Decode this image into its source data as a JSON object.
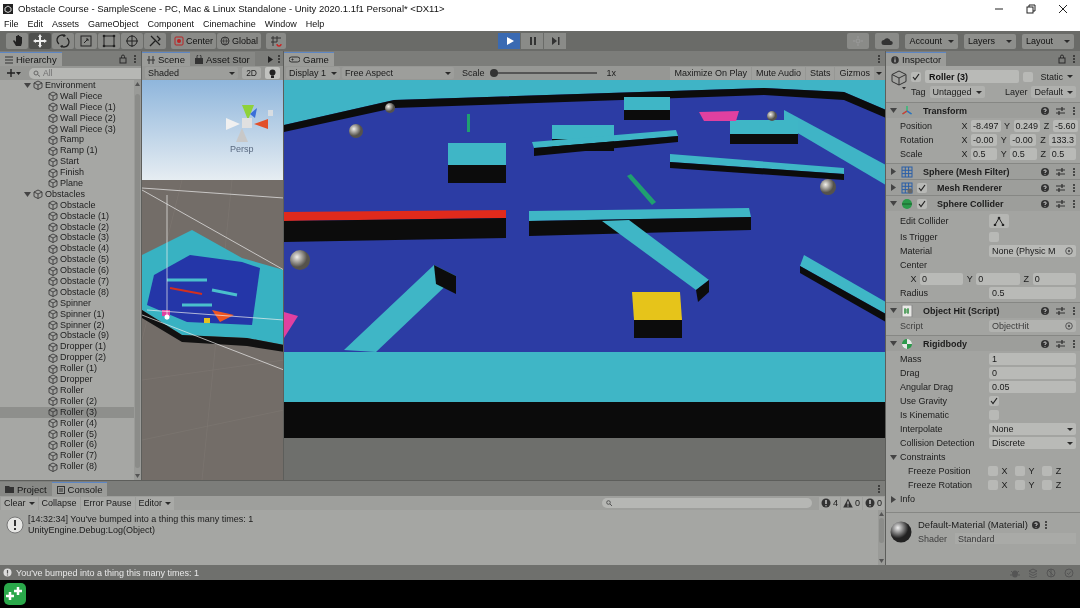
{
  "window": {
    "title": "Obstacle Course - SampleScene - PC, Mac & Linux Standalone - Unity 2020.1.1f1 Personal* <DX11>"
  },
  "menu": [
    "File",
    "Edit",
    "Assets",
    "GameObject",
    "Component",
    "Cinemachine",
    "Window",
    "Help"
  ],
  "toolbar": {
    "tools": [
      {
        "kind": "hand",
        "selected": false
      },
      {
        "kind": "move",
        "selected": true
      },
      {
        "kind": "rotate",
        "selected": false
      },
      {
        "kind": "scale",
        "selected": false
      },
      {
        "kind": "rect",
        "selected": false
      },
      {
        "kind": "transform",
        "selected": false
      },
      {
        "kind": "custom",
        "selected": false
      }
    ],
    "pivot": [
      {
        "kind": "center",
        "label": "Center"
      },
      {
        "kind": "global",
        "label": "Global"
      }
    ],
    "playback": [
      {
        "kind": "play",
        "on": true
      },
      {
        "kind": "pause",
        "on": false
      },
      {
        "kind": "step",
        "on": false
      }
    ],
    "menus": [
      "Account",
      "Layers",
      "Layout"
    ]
  },
  "hierarchy": {
    "title": "Hierarchy",
    "search": {
      "placeholder": "All"
    },
    "items": [
      {
        "label": "Environment",
        "expanded": true,
        "selected": false,
        "children": [
          {
            "label": "Wall Piece",
            "selected": false
          },
          {
            "label": "Wall Piece (1)",
            "selected": false
          },
          {
            "label": "Wall Piece (2)",
            "selected": false
          },
          {
            "label": "Wall Piece (3)",
            "selected": false
          },
          {
            "label": "Ramp",
            "selected": false
          },
          {
            "label": "Ramp (1)",
            "selected": false
          },
          {
            "label": "Start",
            "selected": false
          },
          {
            "label": "Finish",
            "selected": false
          },
          {
            "label": "Plane",
            "selected": false
          }
        ]
      },
      {
        "label": "Obstacles",
        "expanded": true,
        "selected": false,
        "children": [
          {
            "label": "Obstacle",
            "selected": false
          },
          {
            "label": "Obstacle (1)",
            "selected": false
          },
          {
            "label": "Obstacle (2)",
            "selected": false
          },
          {
            "label": "Obstacle (3)",
            "selected": false
          },
          {
            "label": "Obstacle (4)",
            "selected": false
          },
          {
            "label": "Obstacle (5)",
            "selected": false
          },
          {
            "label": "Obstacle (6)",
            "selected": false
          },
          {
            "label": "Obstacle (7)",
            "selected": false
          },
          {
            "label": "Obstacle (8)",
            "selected": false
          },
          {
            "label": "Spinner",
            "selected": false
          },
          {
            "label": "Spinner (1)",
            "selected": false
          },
          {
            "label": "Spinner (2)",
            "selected": false
          },
          {
            "label": "Obstacle (9)",
            "selected": false
          },
          {
            "label": "Dropper (1)",
            "selected": false
          },
          {
            "label": "Dropper (2)",
            "selected": false
          },
          {
            "label": "Roller (1)",
            "selected": false
          },
          {
            "label": "Dropper",
            "selected": false
          },
          {
            "label": "Roller",
            "selected": false
          },
          {
            "label": "Roller (2)",
            "selected": false
          },
          {
            "label": "Roller (3)",
            "selected": true
          },
          {
            "label": "Roller (4)",
            "selected": false
          },
          {
            "label": "Roller (5)",
            "selected": false
          },
          {
            "label": "Roller (6)",
            "selected": false
          },
          {
            "label": "Roller (7)",
            "selected": false
          },
          {
            "label": "Roller (8)",
            "selected": false
          }
        ]
      }
    ]
  },
  "scene": {
    "tabs": [
      {
        "label": "Scene",
        "kind": "scene",
        "selected": true
      },
      {
        "label": "Asset Stor",
        "kind": "store",
        "selected": false
      }
    ],
    "shading": "Shaded",
    "mode_2d": "2D",
    "lighting_on": true,
    "view_label": "Persp"
  },
  "game": {
    "tab": "Game",
    "display": "Display 1",
    "aspect": "Free Aspect",
    "scale_label": "Scale",
    "scale": {
      "level": 0.0
    },
    "scale_reading": "1x",
    "toggles": [
      {
        "label": "Maximize On Play",
        "on": false
      },
      {
        "label": "Mute Audio",
        "on": false
      },
      {
        "label": "Stats",
        "on": false
      },
      {
        "label": "Gizmos",
        "on": false
      }
    ]
  },
  "inspector": {
    "title": "Inspector",
    "object": {
      "name": "Roller (3)",
      "active": true,
      "static_label": "Static",
      "static": false,
      "tag_label": "Tag",
      "tag": "Untagged",
      "layer_label": "Layer",
      "layer": "Default"
    },
    "components": [
      {
        "title": "Transform",
        "kind": "transform",
        "expanded": true,
        "properties": [
          {
            "kind": "vector",
            "label": "Position",
            "axes": [
              {
                "axis": "X",
                "value": "-8.497"
              },
              {
                "axis": "Y",
                "value": "0.249"
              },
              {
                "axis": "Z",
                "value": "-5.60"
              }
            ]
          },
          {
            "kind": "vector",
            "label": "Rotation",
            "axes": [
              {
                "axis": "X",
                "value": "-0.00"
              },
              {
                "axis": "Y",
                "value": "-0.00"
              },
              {
                "axis": "Z",
                "value": "133.3"
              }
            ]
          },
          {
            "kind": "vector",
            "label": "Scale",
            "axes": [
              {
                "axis": "X",
                "value": "0.5"
              },
              {
                "axis": "Y",
                "value": "0.5"
              },
              {
                "axis": "Z",
                "value": "0.5"
              }
            ]
          }
        ]
      },
      {
        "title": "Sphere (Mesh Filter)",
        "kind": "mesh_filter",
        "expanded": false
      },
      {
        "title": "Mesh Renderer",
        "kind": "mesh_renderer",
        "expanded": false,
        "enabled": true
      },
      {
        "title": "Sphere Collider",
        "kind": "collider",
        "expanded": true,
        "enabled": true,
        "properties": [
          {
            "kind": "button",
            "label": "Edit Collider"
          },
          {
            "kind": "checkbox",
            "label": "Is Trigger",
            "checked": false
          },
          {
            "kind": "object",
            "label": "Material",
            "value": "None (Physic M",
            "disabled": false
          },
          {
            "kind": "label",
            "label": "Center"
          },
          {
            "kind": "vector_wide",
            "axes": [
              {
                "axis": "X",
                "value": "0"
              },
              {
                "axis": "Y",
                "value": "0"
              },
              {
                "axis": "Z",
                "value": "0"
              }
            ]
          },
          {
            "kind": "field",
            "label": "Radius",
            "value": "0.5"
          }
        ]
      },
      {
        "title": "Object Hit (Script)",
        "kind": "script",
        "expanded": true,
        "properties": [
          {
            "kind": "object",
            "label": "Script",
            "value": "ObjectHit",
            "disabled": true
          }
        ]
      },
      {
        "title": "Rigidbody",
        "kind": "rigidbody",
        "expanded": true,
        "properties": [
          {
            "kind": "field",
            "label": "Mass",
            "value": "1"
          },
          {
            "kind": "field",
            "label": "Drag",
            "value": "0"
          },
          {
            "kind": "field",
            "label": "Angular Drag",
            "value": "0.05"
          },
          {
            "kind": "checkbox",
            "label": "Use Gravity",
            "checked": true
          },
          {
            "kind": "checkbox",
            "label": "Is Kinematic",
            "checked": false
          },
          {
            "kind": "dropdown",
            "label": "Interpolate",
            "value": "None"
          },
          {
            "kind": "dropdown",
            "label": "Collision Detection",
            "value": "Discrete"
          },
          {
            "kind": "foldout",
            "label": "Constraints",
            "expanded": true,
            "children": [
              {
                "kind": "axis_checks",
                "label": "Freeze Position",
                "axes": [
                  {
                    "axis": "X",
                    "checked": false
                  },
                  {
                    "axis": "Y",
                    "checked": false
                  },
                  {
                    "axis": "Z",
                    "checked": false
                  }
                ]
              },
              {
                "kind": "axis_checks",
                "label": "Freeze Rotation",
                "axes": [
                  {
                    "axis": "X",
                    "checked": false
                  },
                  {
                    "axis": "Y",
                    "checked": false
                  },
                  {
                    "axis": "Z",
                    "checked": false
                  }
                ]
              }
            ]
          },
          {
            "kind": "foldout",
            "label": "Info",
            "expanded": false
          }
        ]
      }
    ],
    "material": {
      "name": "Default-Material (Material)",
      "shader_label": "Shader",
      "shader": "Standard"
    }
  },
  "console": {
    "tabs": [
      {
        "label": "Project",
        "kind": "folder",
        "selected": false
      },
      {
        "label": "Console",
        "kind": "console",
        "selected": true
      }
    ],
    "buttons": [
      {
        "label": "Clear",
        "dropdown": true
      },
      {
        "label": "Collapse",
        "dropdown": false
      },
      {
        "label": "Error Pause",
        "dropdown": false
      },
      {
        "label": "Editor",
        "dropdown": true
      }
    ],
    "counts": [
      {
        "kind": "info",
        "count": "4"
      },
      {
        "kind": "warning",
        "count": "0"
      },
      {
        "kind": "error",
        "count": "0"
      }
    ],
    "entries": [
      {
        "kind": "info",
        "lines": [
          "[14:32:34] You've bumped into a thing this many times: 1",
          "UnityEngine.Debug:Log(Object)"
        ]
      }
    ]
  },
  "status_bar": {
    "kind": "info",
    "message": "You've bumped into a thing this many times: 1"
  }
}
